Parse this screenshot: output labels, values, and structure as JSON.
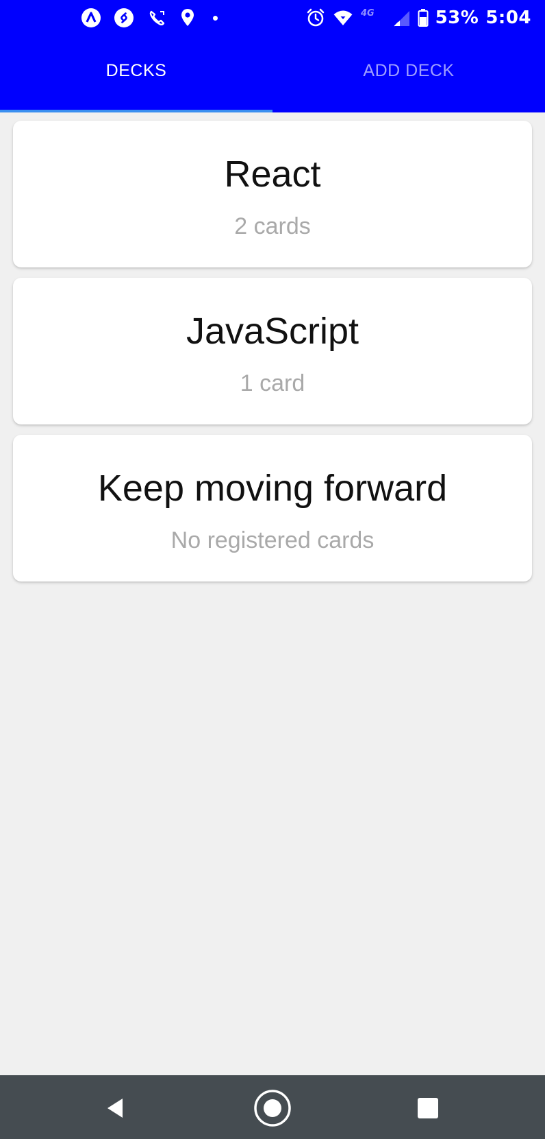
{
  "status_bar": {
    "battery": "53%",
    "time": "5:04",
    "network": "4G",
    "left_icons": [
      "arc-app-icon",
      "shazam-icon",
      "phone-app-icon",
      "location-pin-icon",
      "dot-icon"
    ],
    "right_icons": [
      "alarm-icon",
      "wifi-icon",
      "signal-icon",
      "battery-icon"
    ]
  },
  "tabs": [
    {
      "label": "DECKS",
      "active": true
    },
    {
      "label": "ADD DECK",
      "active": false
    }
  ],
  "decks": [
    {
      "title": "React",
      "count": "2 cards"
    },
    {
      "title": "JavaScript",
      "count": "1 card"
    },
    {
      "title": "Keep moving forward",
      "count": "No registered cards"
    }
  ],
  "nav_bar": {
    "buttons": [
      "back-icon",
      "home-icon",
      "recents-icon"
    ]
  },
  "colors": {
    "header": "#0000fe",
    "tab_indicator": "#3a8ff0",
    "background": "#f0f0f0",
    "card": "#ffffff",
    "subtitle": "#a9a9a9",
    "nav_bar": "#454c51"
  }
}
